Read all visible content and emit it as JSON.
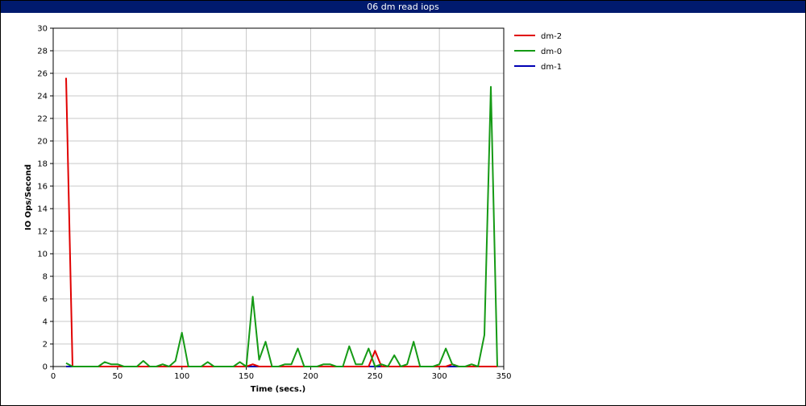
{
  "chart_data": {
    "type": "line",
    "title": "06 dm read iops",
    "xlabel": "Time (secs.)",
    "ylabel": "IO Ops/Second",
    "xlim": [
      0,
      350
    ],
    "ylim": [
      0,
      30
    ],
    "xticks": [
      "0",
      "50",
      "100",
      "150",
      "200",
      "250",
      "300",
      "350"
    ],
    "yticks": [
      "0",
      "2",
      "4",
      "6",
      "8",
      "10",
      "12",
      "14",
      "16",
      "18",
      "20",
      "22",
      "24",
      "26",
      "28",
      "30"
    ],
    "grid": true,
    "legend_position": "right",
    "series": [
      {
        "name": "dm-2",
        "color": "#e00000",
        "points": [
          [
            10,
            25.6
          ],
          [
            15,
            0
          ],
          [
            20,
            0
          ],
          [
            30,
            0
          ],
          [
            40,
            0
          ],
          [
            50,
            0
          ],
          [
            60,
            0
          ],
          [
            70,
            0
          ],
          [
            80,
            0
          ],
          [
            90,
            0
          ],
          [
            100,
            0
          ],
          [
            110,
            0
          ],
          [
            120,
            0
          ],
          [
            130,
            0
          ],
          [
            140,
            0
          ],
          [
            150,
            0
          ],
          [
            155,
            0.2
          ],
          [
            160,
            0
          ],
          [
            170,
            0
          ],
          [
            180,
            0
          ],
          [
            190,
            0
          ],
          [
            200,
            0
          ],
          [
            210,
            0
          ],
          [
            220,
            0
          ],
          [
            230,
            0
          ],
          [
            240,
            0
          ],
          [
            245,
            0
          ],
          [
            250,
            1.4
          ],
          [
            255,
            0
          ],
          [
            260,
            0
          ],
          [
            270,
            0
          ],
          [
            280,
            0
          ],
          [
            290,
            0
          ],
          [
            300,
            0
          ],
          [
            305,
            0
          ],
          [
            310,
            0.2
          ],
          [
            315,
            0
          ],
          [
            320,
            0
          ],
          [
            330,
            0
          ],
          [
            340,
            0
          ],
          [
            345,
            0
          ]
        ]
      },
      {
        "name": "dm-0",
        "color": "#159a15",
        "points": [
          [
            10,
            0.3
          ],
          [
            15,
            0
          ],
          [
            20,
            0
          ],
          [
            25,
            0
          ],
          [
            30,
            0
          ],
          [
            35,
            0
          ],
          [
            40,
            0.4
          ],
          [
            45,
            0.2
          ],
          [
            50,
            0.2
          ],
          [
            55,
            0
          ],
          [
            60,
            0
          ],
          [
            65,
            0
          ],
          [
            70,
            0.5
          ],
          [
            75,
            0
          ],
          [
            80,
            0
          ],
          [
            85,
            0.2
          ],
          [
            90,
            0
          ],
          [
            95,
            0.5
          ],
          [
            100,
            3.0
          ],
          [
            105,
            0
          ],
          [
            110,
            0
          ],
          [
            115,
            0
          ],
          [
            120,
            0.4
          ],
          [
            125,
            0
          ],
          [
            130,
            0
          ],
          [
            135,
            0
          ],
          [
            140,
            0
          ],
          [
            145,
            0.4
          ],
          [
            150,
            0
          ],
          [
            155,
            6.2
          ],
          [
            160,
            0.6
          ],
          [
            165,
            2.2
          ],
          [
            170,
            0
          ],
          [
            175,
            0
          ],
          [
            180,
            0.2
          ],
          [
            185,
            0.2
          ],
          [
            190,
            1.6
          ],
          [
            195,
            0
          ],
          [
            200,
            0
          ],
          [
            205,
            0
          ],
          [
            210,
            0.2
          ],
          [
            215,
            0.2
          ],
          [
            220,
            0
          ],
          [
            225,
            0
          ],
          [
            230,
            1.8
          ],
          [
            235,
            0.2
          ],
          [
            240,
            0.2
          ],
          [
            245,
            1.6
          ],
          [
            250,
            0
          ],
          [
            255,
            0.2
          ],
          [
            260,
            0
          ],
          [
            265,
            1.0
          ],
          [
            270,
            0
          ],
          [
            275,
            0.2
          ],
          [
            280,
            2.2
          ],
          [
            285,
            0
          ],
          [
            290,
            0
          ],
          [
            295,
            0
          ],
          [
            300,
            0.2
          ],
          [
            305,
            1.6
          ],
          [
            310,
            0.2
          ],
          [
            315,
            0
          ],
          [
            320,
            0
          ],
          [
            325,
            0.2
          ],
          [
            330,
            0
          ],
          [
            335,
            2.8
          ],
          [
            340,
            24.8
          ],
          [
            345,
            0
          ]
        ]
      },
      {
        "name": "dm-1",
        "color": "#0000b4",
        "points": [
          [
            10,
            0
          ],
          [
            50,
            0
          ],
          [
            100,
            0
          ],
          [
            150,
            0
          ],
          [
            200,
            0
          ],
          [
            250,
            0
          ],
          [
            300,
            0
          ],
          [
            345,
            0
          ]
        ]
      }
    ]
  }
}
